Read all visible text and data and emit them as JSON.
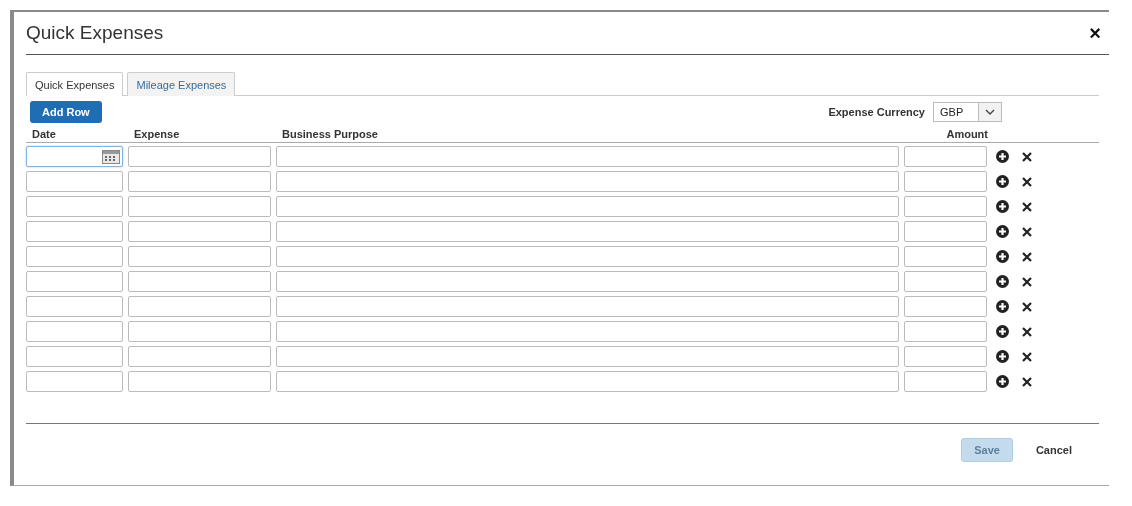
{
  "window": {
    "title": "Quick Expenses",
    "close": "×"
  },
  "tabs": [
    {
      "label": "Quick Expenses",
      "selected": true
    },
    {
      "label": "Mileage Expenses",
      "selected": false
    }
  ],
  "add_row_button": "Add Row",
  "currency": {
    "label": "Expense Currency",
    "value": "GBP"
  },
  "columns": [
    "Date",
    "Expense",
    "Business Purpose",
    "Amount"
  ],
  "rows": [
    {
      "focused": true
    },
    {
      "focused": false
    },
    {
      "focused": false
    },
    {
      "focused": false
    },
    {
      "focused": false
    },
    {
      "focused": false
    },
    {
      "focused": false
    },
    {
      "focused": false
    },
    {
      "focused": false
    },
    {
      "focused": false
    }
  ],
  "buttons": [
    {
      "label": "Save",
      "disabled": true
    },
    {
      "label": "Cancel",
      "disabled": false
    }
  ]
}
